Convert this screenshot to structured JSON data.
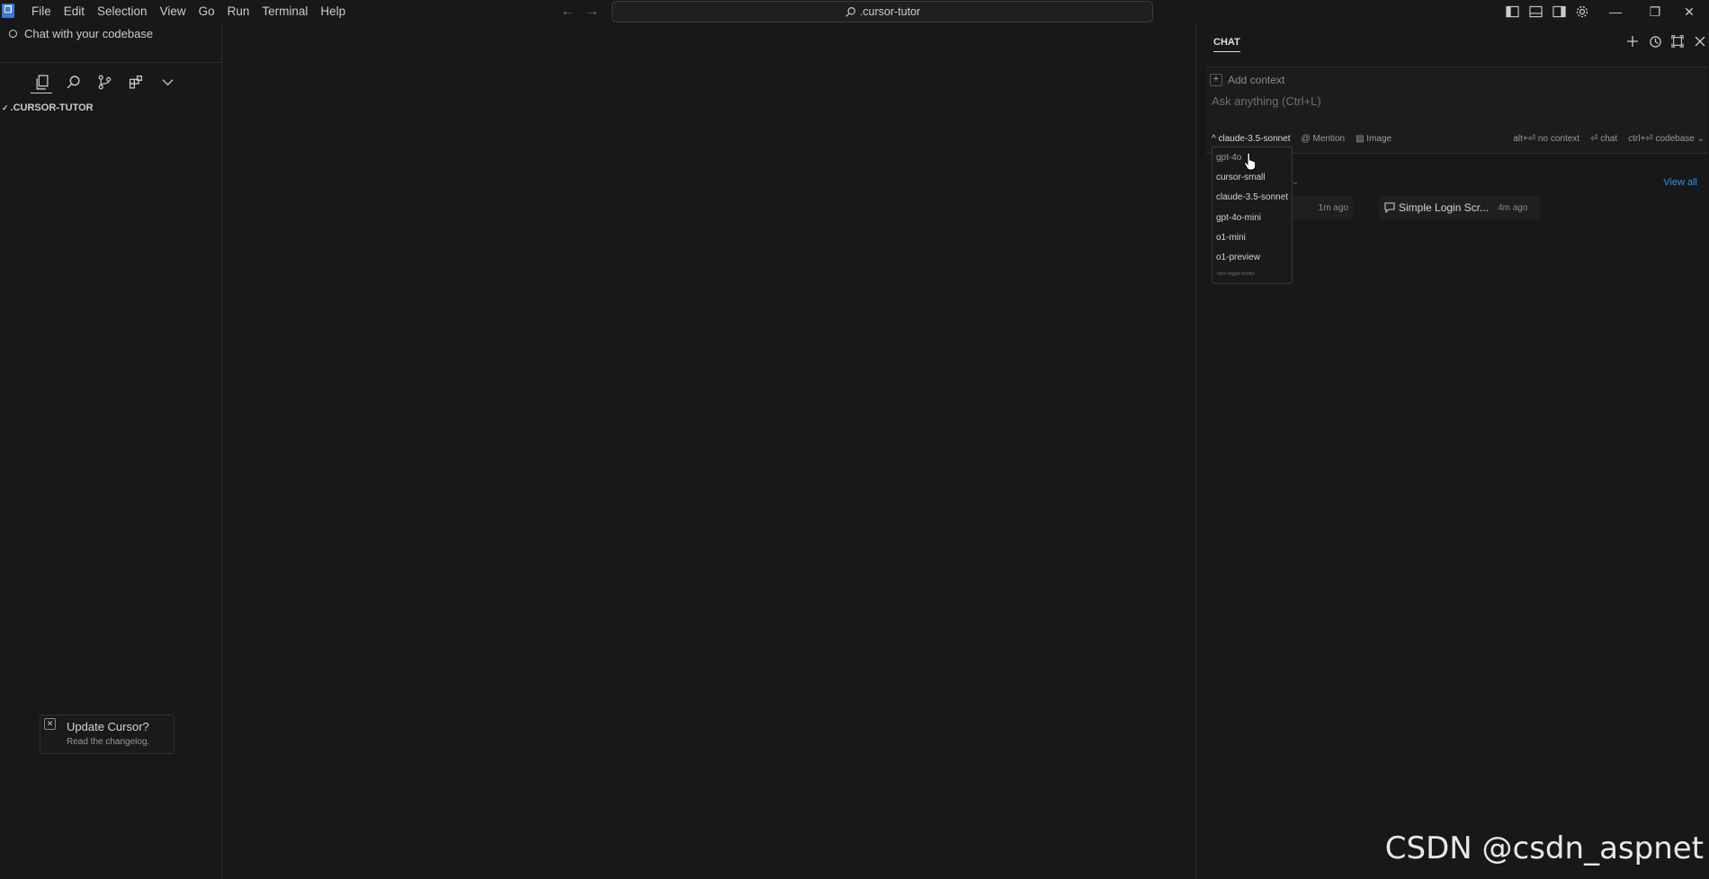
{
  "menubar": {
    "items": [
      "File",
      "Edit",
      "Selection",
      "View",
      "Go",
      "Run",
      "Terminal",
      "Help"
    ]
  },
  "command_center": {
    "label": ".cursor-tutor"
  },
  "sidebar": {
    "chat_hint": "Chat with your codebase",
    "explorer_title": ".CURSOR-TUTOR"
  },
  "notification": {
    "title": "Update Cursor?",
    "subtitle": "Read the changelog."
  },
  "chat": {
    "tab_label": "CHAT",
    "add_context": "Add context",
    "placeholder": "Ask anything (Ctrl+L)",
    "model_selected": "claude-3.5-sonnet",
    "mention": "Mention",
    "image": "Image",
    "no_context": "alt+⏎ no context",
    "chat_shortcut": "⏎ chat",
    "codebase": "ctrl+⏎ codebase",
    "view_all": "View all",
    "recent": [
      {
        "title": "",
        "time": "1m ago"
      },
      {
        "title": "Simple Login Scr...",
        "time": "4m ago"
      }
    ]
  },
  "model_dropdown": {
    "options": [
      "gpt-4o",
      "cursor-small",
      "claude-3.5-sonnet",
      "gpt-4o-mini",
      "o1-mini",
      "o1-preview"
    ],
    "footer": "ctrl+/ toggle model"
  },
  "watermark": "CSDN @csdn_aspnet",
  "colors": {
    "background": "#181818",
    "accent_link": "#3f8fd8"
  }
}
